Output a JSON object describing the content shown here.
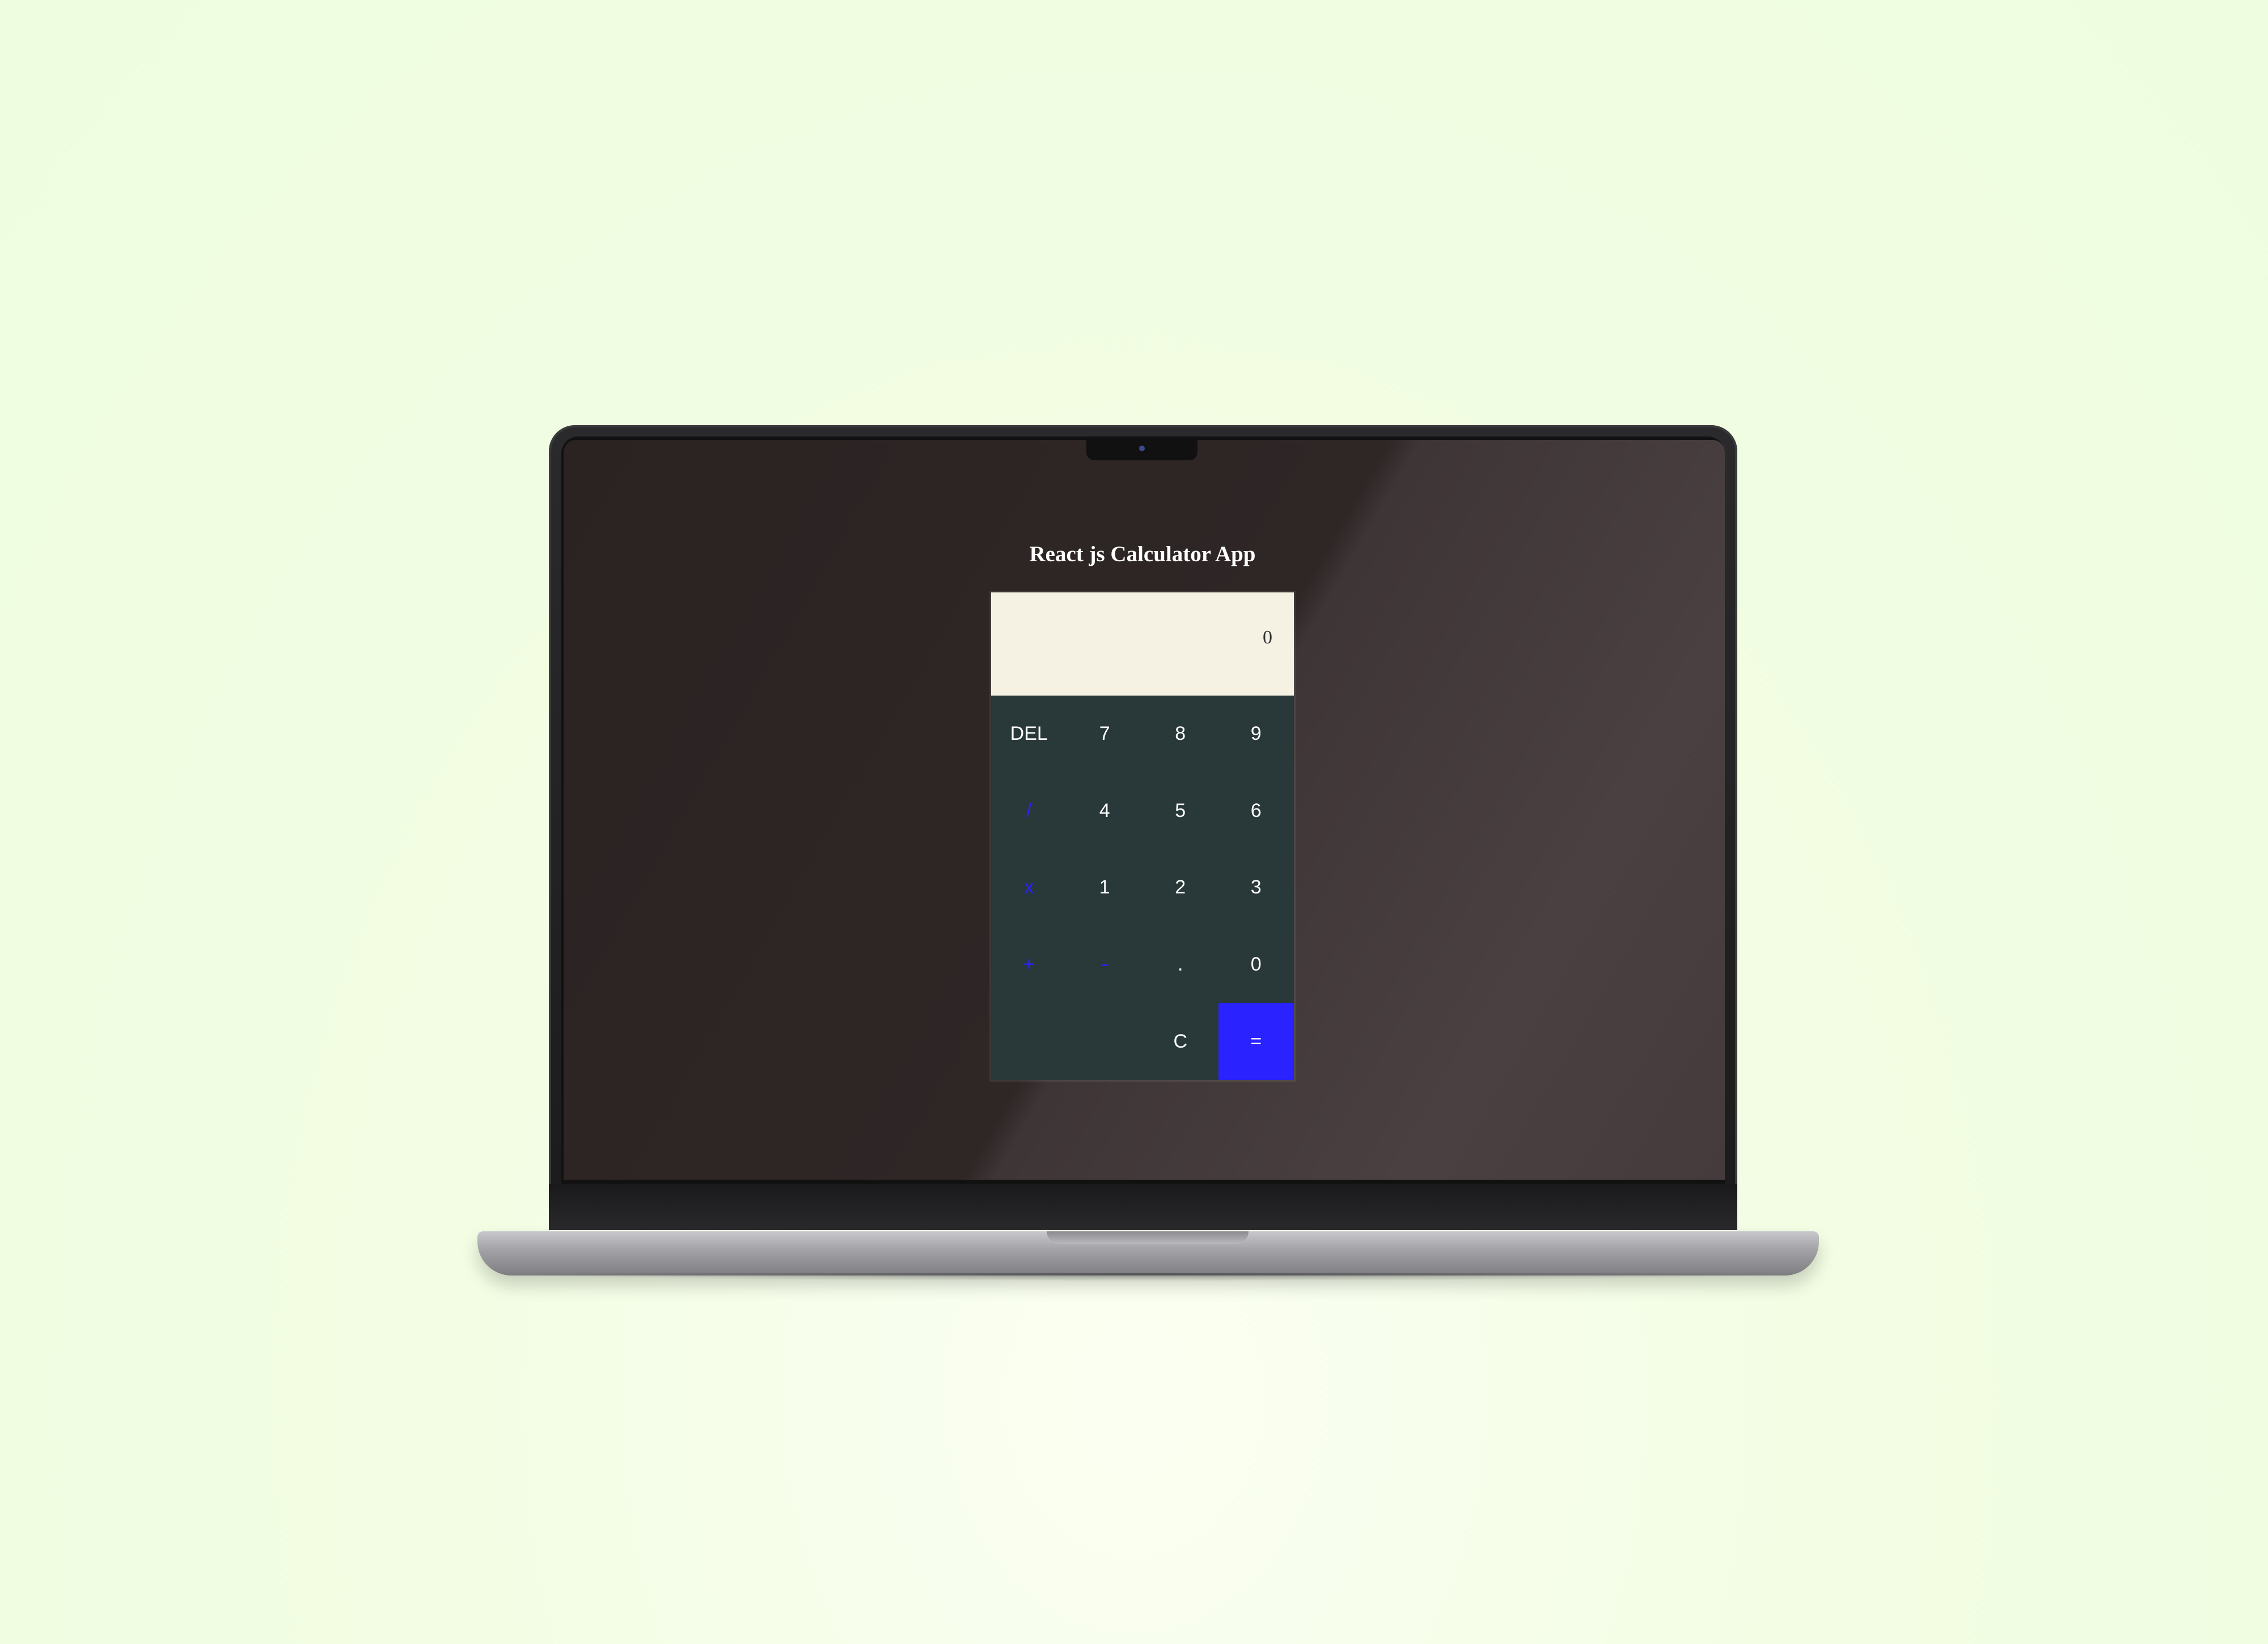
{
  "app": {
    "title": "React js Calculator App",
    "display_value": "0"
  },
  "keypad": {
    "rows": [
      [
        "DEL",
        "7",
        "8",
        "9"
      ],
      [
        "/",
        "4",
        "5",
        "6"
      ],
      [
        "x",
        "1",
        "2",
        "3"
      ],
      [
        "+",
        "-",
        ".",
        "0"
      ],
      [
        "",
        "",
        "C",
        "="
      ]
    ]
  },
  "colors": {
    "operator_accent": "#2a22ff",
    "equals_background": "#2a22ff",
    "keypad_background": "#293839",
    "display_background": "#f5f2e4",
    "page_background": "#eefddf"
  }
}
